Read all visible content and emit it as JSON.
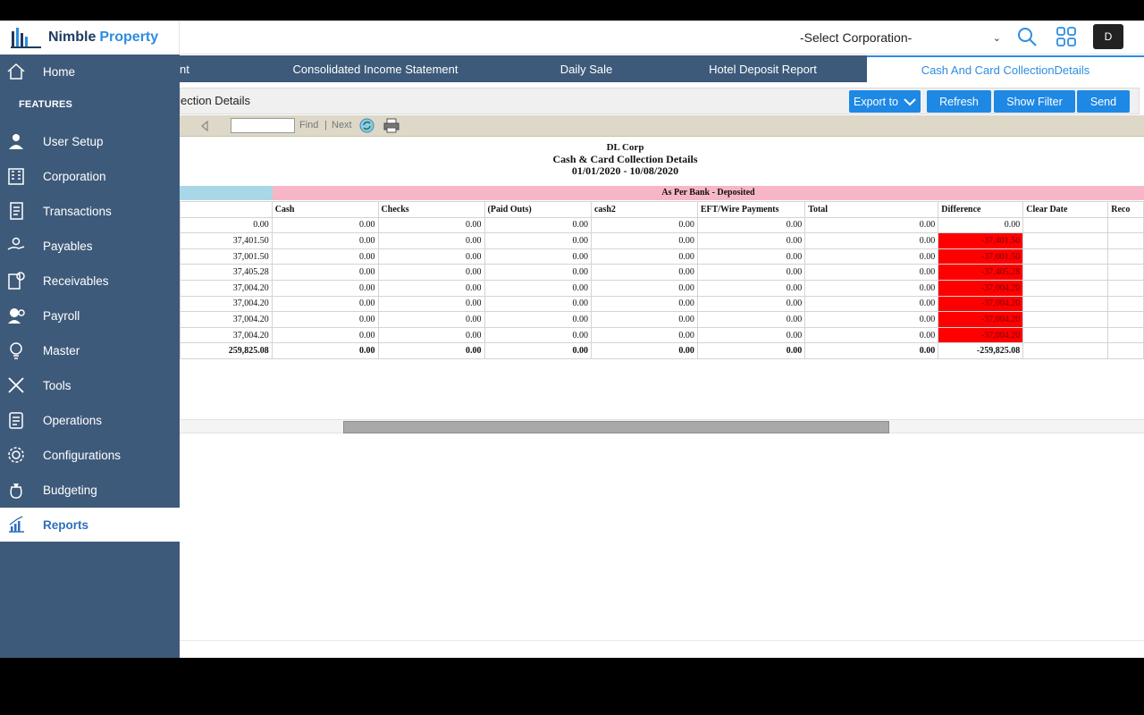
{
  "app": {
    "brand_part1": "Nimble",
    "brand_part2": "Property",
    "accent": "#2d8de0",
    "sidebar_bg": "#3e5a7a"
  },
  "header": {
    "corp_select": "-Select Corporation-",
    "avatar": "D"
  },
  "sidebar": {
    "home": "Home",
    "features_label": "FEATURES",
    "items": [
      {
        "label": "User Setup",
        "icon": "user-setup-icon"
      },
      {
        "label": "Corporation",
        "icon": "building-icon"
      },
      {
        "label": "Transactions",
        "icon": "transactions-icon"
      },
      {
        "label": "Payables",
        "icon": "payables-icon"
      },
      {
        "label": "Receivables",
        "icon": "receivables-icon"
      },
      {
        "label": "Payroll",
        "icon": "payroll-icon"
      },
      {
        "label": "Master",
        "icon": "master-icon"
      },
      {
        "label": "Tools",
        "icon": "tools-icon"
      },
      {
        "label": "Operations",
        "icon": "operations-icon"
      },
      {
        "label": "Configurations",
        "icon": "configurations-icon"
      },
      {
        "label": "Budgeting",
        "icon": "budgeting-icon"
      },
      {
        "label": "Reports",
        "icon": "reports-icon",
        "active": true
      }
    ]
  },
  "tabs": [
    {
      "label": "nt"
    },
    {
      "label": "Consolidated Income Statement"
    },
    {
      "label": "Daily Sale"
    },
    {
      "label": "Hotel Deposit Report"
    },
    {
      "label": "Cash And Card CollectionDetails",
      "active": true
    }
  ],
  "report_header": {
    "title": "ection Details",
    "export_label": "Export to",
    "refresh_label": "Refresh",
    "show_filter_label": "Show Filter",
    "send_label": "Send"
  },
  "viewer": {
    "find_label": "Find",
    "separator": "|",
    "next_label": "Next",
    "find_value": ""
  },
  "report": {
    "corp": "DL Corp",
    "title": "Cash & Card Collection Details",
    "date_range": "01/01/2020 - 10/08/2020",
    "group_label": "As Per Bank - Deposited",
    "columns": [
      "",
      "Cash",
      "Checks",
      "(Paid Outs)",
      "cash2",
      "EFT/Wire Payments",
      "Total",
      "Difference",
      "Clear Date",
      "Reco"
    ],
    "rows": [
      [
        "0.00",
        "0.00",
        "0.00",
        "0.00",
        "0.00",
        "0.00",
        "0.00",
        "0.00",
        "",
        ""
      ],
      [
        "37,401.50",
        "0.00",
        "0.00",
        "0.00",
        "0.00",
        "0.00",
        "0.00",
        "-37,401.50",
        "",
        ""
      ],
      [
        "37,001.50",
        "0.00",
        "0.00",
        "0.00",
        "0.00",
        "0.00",
        "0.00",
        "-37,001.50",
        "",
        ""
      ],
      [
        "37,405.28",
        "0.00",
        "0.00",
        "0.00",
        "0.00",
        "0.00",
        "0.00",
        "-37,405.28",
        "",
        ""
      ],
      [
        "37,004.20",
        "0.00",
        "0.00",
        "0.00",
        "0.00",
        "0.00",
        "0.00",
        "-37,004.20",
        "",
        ""
      ],
      [
        "37,004.20",
        "0.00",
        "0.00",
        "0.00",
        "0.00",
        "0.00",
        "0.00",
        "-37,004.20",
        "",
        ""
      ],
      [
        "37,004.20",
        "0.00",
        "0.00",
        "0.00",
        "0.00",
        "0.00",
        "0.00",
        "-37,004.20",
        "",
        ""
      ],
      [
        "37,004.20",
        "0.00",
        "0.00",
        "0.00",
        "0.00",
        "0.00",
        "0.00",
        "-37,004.20",
        "",
        ""
      ]
    ],
    "total_row": [
      "259,825.08",
      "0.00",
      "0.00",
      "0.00",
      "0.00",
      "0.00",
      "0.00",
      "-259,825.08",
      "",
      ""
    ],
    "highlight_color": "#ff0000"
  }
}
